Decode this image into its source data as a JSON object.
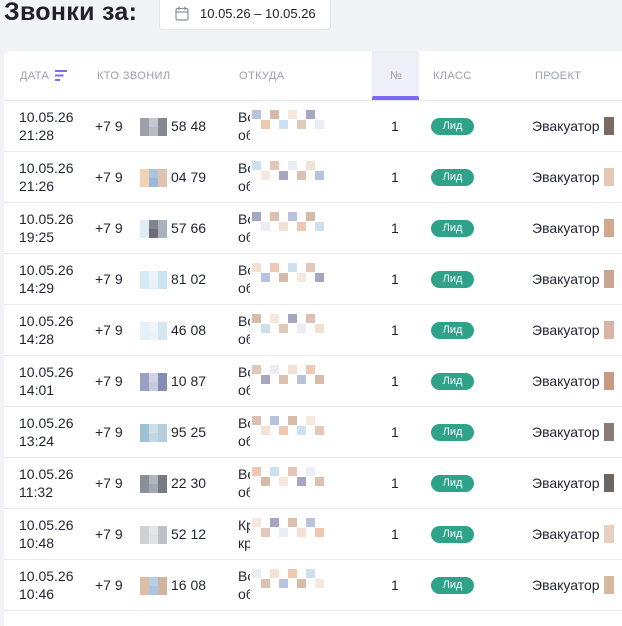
{
  "page": {
    "title": "Звонки за:",
    "date_range": "10.05.26 – 10.05.26"
  },
  "table": {
    "columns": {
      "date": "ДАТА",
      "caller": "КТО ЗВОНИЛ",
      "source": "ОТКУДА",
      "num": "№",
      "class": "КЛАСС",
      "project": "ПРОЕКТ"
    },
    "rows": [
      {
        "date": "10.05.26",
        "time": "21:28",
        "phone_prefix": "+7 9",
        "phone_suffix": "58 48",
        "source_1": "Во",
        "source_2": "об",
        "num": "1",
        "class": "Лид",
        "project": "Эвакуатор"
      },
      {
        "date": "10.05.26",
        "time": "21:26",
        "phone_prefix": "+7 9",
        "phone_suffix": "04 79",
        "source_1": "Во",
        "source_2": "об",
        "num": "1",
        "class": "Лид",
        "project": "Эвакуатор"
      },
      {
        "date": "10.05.26",
        "time": "19:25",
        "phone_prefix": "+7 9",
        "phone_suffix": "57 66",
        "source_1": "Во",
        "source_2": "об",
        "num": "1",
        "class": "Лид",
        "project": "Эвакуатор"
      },
      {
        "date": "10.05.26",
        "time": "14:29",
        "phone_prefix": "+7 9",
        "phone_suffix": "81 02",
        "source_1": "Во",
        "source_2": "об",
        "num": "1",
        "class": "Лид",
        "project": "Эвакуатор"
      },
      {
        "date": "10.05.26",
        "time": "14:28",
        "phone_prefix": "+7 9",
        "phone_suffix": "46 08",
        "source_1": "Во",
        "source_2": "об",
        "num": "1",
        "class": "Лид",
        "project": "Эвакуатор"
      },
      {
        "date": "10.05.26",
        "time": "14:01",
        "phone_prefix": "+7 9",
        "phone_suffix": "10 87",
        "source_1": "Во",
        "source_2": "об",
        "num": "1",
        "class": "Лид",
        "project": "Эвакуатор"
      },
      {
        "date": "10.05.26",
        "time": "13:24",
        "phone_prefix": "+7 9",
        "phone_suffix": "95 25",
        "source_1": "Во",
        "source_2": "об",
        "num": "1",
        "class": "Лид",
        "project": "Эвакуатор"
      },
      {
        "date": "10.05.26",
        "time": "11:32",
        "phone_prefix": "+7 9",
        "phone_suffix": "22 30",
        "source_1": "Во",
        "source_2": "об",
        "num": "1",
        "class": "Лид",
        "project": "Эвакуатор"
      },
      {
        "date": "10.05.26",
        "time": "10:48",
        "phone_prefix": "+7 9",
        "phone_suffix": "52 12",
        "source_1": "Кр",
        "source_2": "кр",
        "num": "1",
        "class": "Лид",
        "project": "Эвакуатор"
      },
      {
        "date": "10.05.26",
        "time": "10:46",
        "phone_prefix": "+7 9",
        "phone_suffix": "16 08",
        "source_1": "Во",
        "source_2": "об",
        "num": "1",
        "class": "Лид",
        "project": "Эвакуатор"
      }
    ]
  },
  "colors": {
    "accent": "#7d68f2",
    "badge": "#2fa38a",
    "header_text": "#9aa0ad",
    "background": "#f2f3f6"
  }
}
